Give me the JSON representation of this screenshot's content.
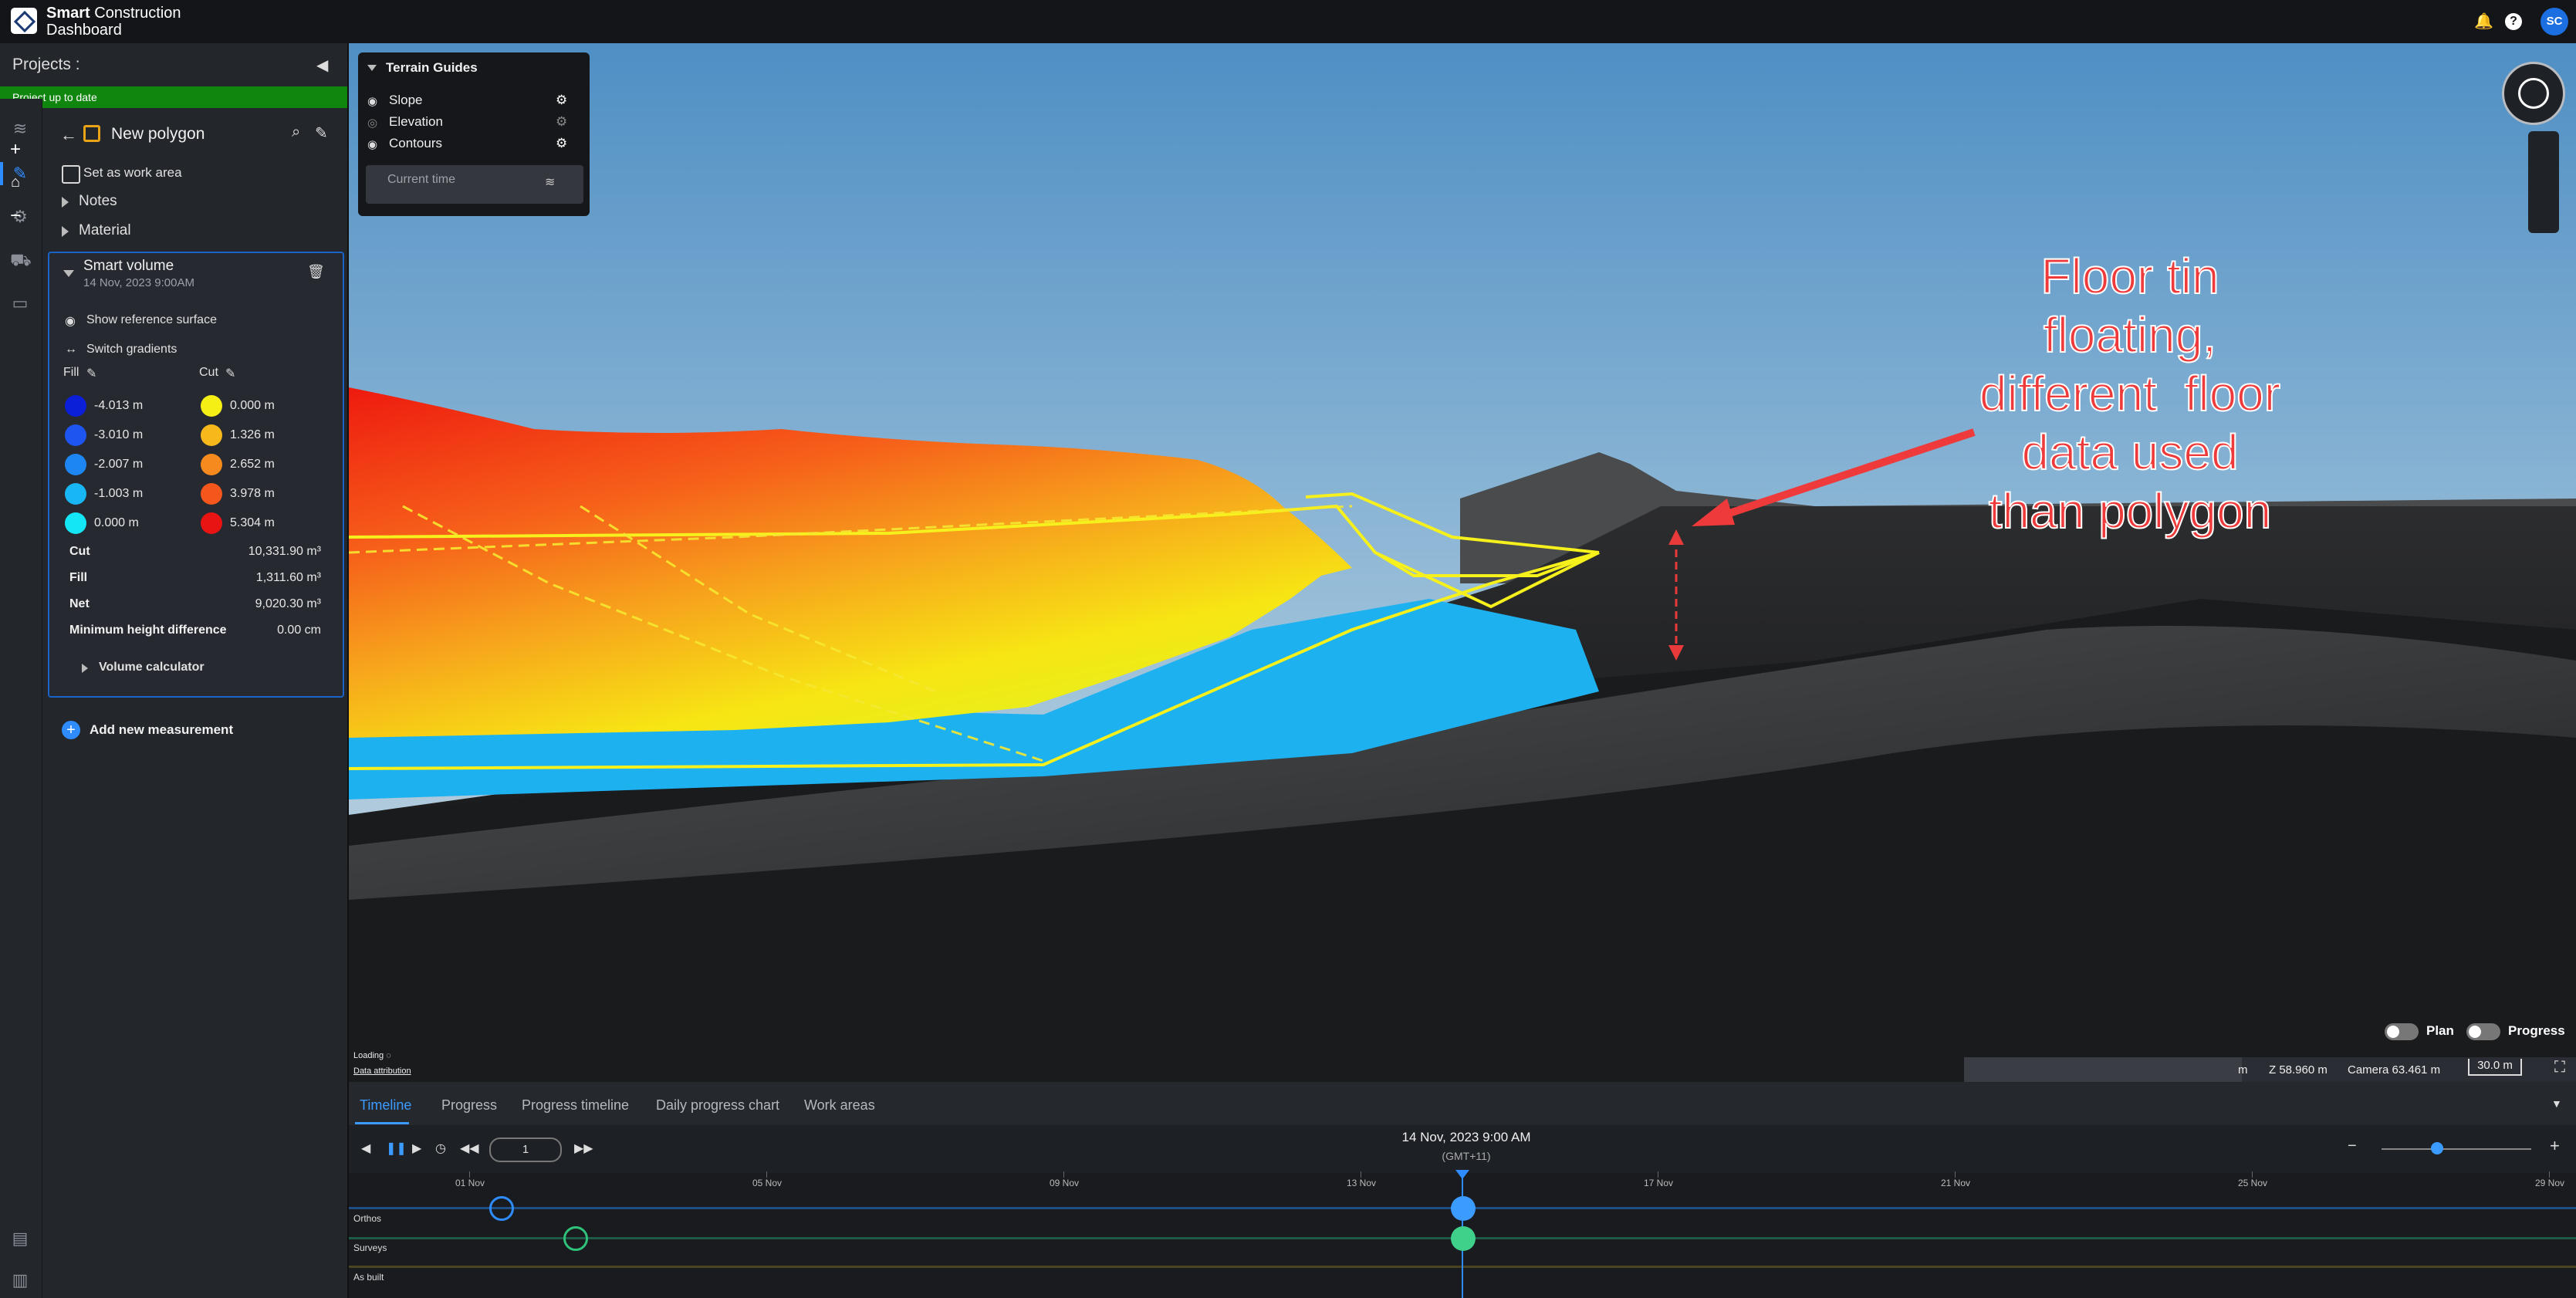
{
  "header": {
    "brand_line1_bold": "Smart",
    "brand_line1_rest": " Construction",
    "brand_line2": "Dashboard",
    "bell_icon": "bell-icon",
    "help_icon": "help-icon",
    "avatar_text": "SC"
  },
  "sidebar": {
    "title": "Projects",
    "status": "Project up to date"
  },
  "polygon": {
    "title": "New polygon",
    "work_area_label": "Set as work area",
    "notes_label": "Notes",
    "material_label": "Material"
  },
  "smart_volume": {
    "title": "Smart volume",
    "date": "14 Nov, 2023 9:00AM",
    "show_ref_label": "Show reference surface",
    "switch_gradients_label": "Switch gradients",
    "fill_label": "Fill",
    "cut_label": "Cut",
    "fill_scale": [
      {
        "value": "-4.013 m",
        "color": "#0b1fd8"
      },
      {
        "value": "-3.010 m",
        "color": "#1e55f0"
      },
      {
        "value": "-2.007 m",
        "color": "#1e86f2"
      },
      {
        "value": "-1.003 m",
        "color": "#19b6f5"
      },
      {
        "value": "0.000 m",
        "color": "#14e6f6"
      }
    ],
    "cut_scale": [
      {
        "value": "0.000 m",
        "color": "#f6ef16"
      },
      {
        "value": "1.326 m",
        "color": "#f7b81b"
      },
      {
        "value": "2.652 m",
        "color": "#f68a1e"
      },
      {
        "value": "3.978 m",
        "color": "#f4561c"
      },
      {
        "value": "5.304 m",
        "color": "#e81414"
      }
    ],
    "stats": [
      {
        "label": "Cut",
        "value": "10,331.90 m³"
      },
      {
        "label": "Fill",
        "value": "1,311.60 m³"
      },
      {
        "label": "Net",
        "value": "9,020.30 m³"
      },
      {
        "label": "Minimum height difference",
        "value": "0.00 cm"
      }
    ],
    "volume_calculator_label": "Volume calculator"
  },
  "add_measurement_label": "Add new measurement",
  "terrain_guides": {
    "title": "Terrain Guides",
    "items": [
      "Slope",
      "Elevation",
      "Contours"
    ],
    "current_time": "Current time"
  },
  "annotation": {
    "lines": [
      "Floor tin",
      "floating,",
      "different  floor",
      "data used",
      "than polygon"
    ]
  },
  "map_footer": {
    "loading": "Loading",
    "data_attribution": "Data attribution",
    "plan_label": "Plan",
    "progress_label": "Progress",
    "m_label": "m",
    "z_readout": "Z 58.960 m",
    "camera_readout": "Camera 63.461 m",
    "scale": "30.0 m"
  },
  "timeline": {
    "tabs": [
      "Timeline",
      "Progress",
      "Progress timeline",
      "Daily progress chart",
      "Work areas"
    ],
    "page": "1",
    "current_date": "14 Nov, 2023 9:00 AM",
    "timezone": "(GMT+11)",
    "dates": [
      "01 Nov",
      "05 Nov",
      "09 Nov",
      "13 Nov",
      "17 Nov",
      "21 Nov",
      "25 Nov",
      "29 Nov"
    ],
    "rows": [
      "Orthos",
      "Surveys",
      "As built"
    ]
  }
}
